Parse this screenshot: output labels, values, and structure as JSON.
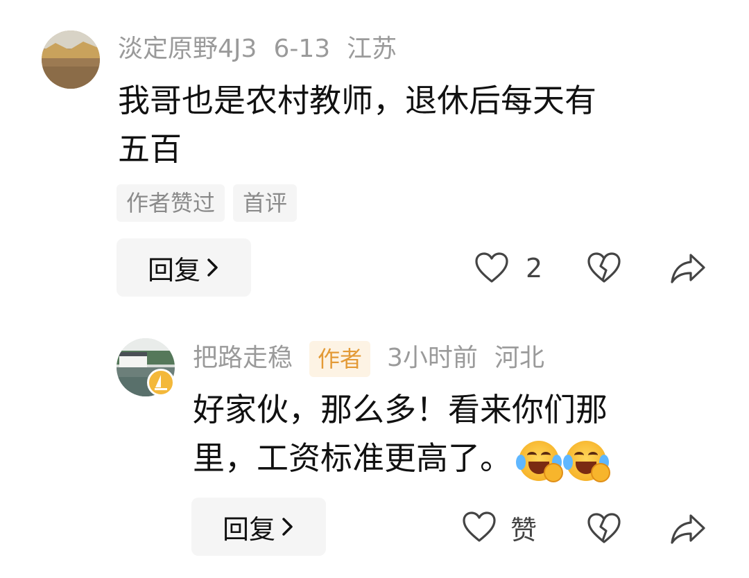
{
  "comment1": {
    "username": "淡定原野4J3",
    "date": "6-13",
    "location": "江苏",
    "text_line1": "我哥也是农村教师，退休后每天有",
    "text_line2": "五百",
    "tags": [
      "作者赞过",
      "首评"
    ],
    "reply_label": "回复",
    "like_count": "2",
    "icons": {
      "like": "heart-icon",
      "dislike": "broken-heart-icon",
      "share": "share-arrow-icon",
      "chevron": "chevron-right-icon"
    }
  },
  "comment2": {
    "username": "把路走稳",
    "author_badge": "作者",
    "time": "3小时前",
    "location": "河北",
    "text_line1": "好家伙，那么多！看来你们那",
    "text_line2": "里，工资标准更高了。",
    "emojis": [
      "laugh-cry-emoji",
      "laugh-cry-emoji"
    ],
    "reply_label": "回复",
    "like_label": "赞",
    "icons": {
      "like": "heart-icon",
      "dislike": "broken-heart-icon",
      "share": "share-arrow-icon",
      "chevron": "chevron-right-icon",
      "verified": "verified-badge-icon"
    }
  }
}
